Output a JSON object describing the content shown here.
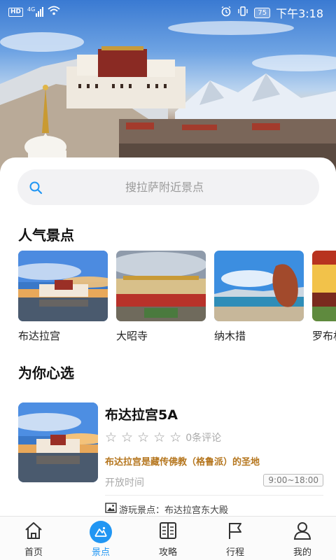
{
  "status_bar": {
    "hd": "HD",
    "network": "4G",
    "battery": "75",
    "time": "下午3:18"
  },
  "search": {
    "placeholder": "搜拉萨附近景点",
    "icon": "search-icon"
  },
  "popular": {
    "title": "人气景点",
    "items": [
      {
        "label": "布达拉宫"
      },
      {
        "label": "大昭寺"
      },
      {
        "label": "纳木措"
      },
      {
        "label": "罗布林"
      }
    ]
  },
  "recommend": {
    "title": "为你心选",
    "item": {
      "name": "布达拉宫5A",
      "rating": 0,
      "reviews": "0条评论",
      "desc": "布达拉宫是藏传佛教（格鲁派）的圣地",
      "open_label": "开放时间",
      "open_time": "9:00~18:00",
      "sub": "游玩景点：布达拉宫东大殿"
    }
  },
  "nav": {
    "items": [
      {
        "label": "首页",
        "icon": "home-icon"
      },
      {
        "label": "景点",
        "icon": "scenic-icon"
      },
      {
        "label": "攻略",
        "icon": "guide-book-icon"
      },
      {
        "label": "行程",
        "icon": "flag-icon"
      },
      {
        "label": "我的",
        "icon": "profile-icon"
      }
    ],
    "active": 1
  },
  "colors": {
    "accent": "#2196f3",
    "desc": "#b5761e",
    "search_bg": "#f2f2f4"
  }
}
